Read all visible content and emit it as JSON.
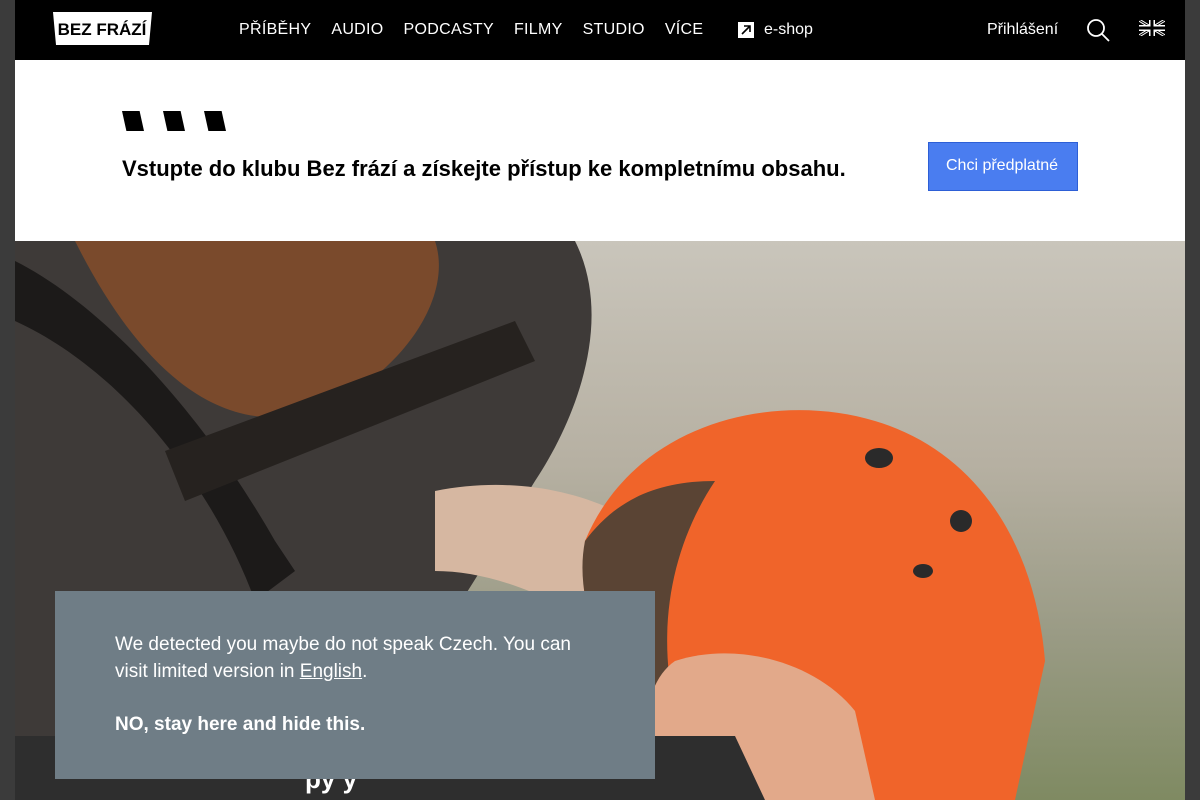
{
  "header": {
    "logo_text": "BEZ FRÁZÍ",
    "nav": [
      "PŘÍBĚHY",
      "AUDIO",
      "PODCASTY",
      "FILMY",
      "STUDIO",
      "VÍCE"
    ],
    "eshop_label": "e-shop",
    "login_label": "Přihlášení",
    "search_icon": "search-icon",
    "language_icon": "uk-flag-icon"
  },
  "promo": {
    "text": "Vstupte do klubu Bez frází a získejte přístup ke kompletnímu obsahu.",
    "button_label": "Chci předplatné",
    "button_color": "#4a7df0"
  },
  "hero": {
    "title_fragment": "py       y",
    "image_alt": "Woman in an orange polo helmet leaning against a horse"
  },
  "language_notice": {
    "message": "We detected you maybe do not speak Czech. You can visit limited version in ",
    "link_label": "English",
    "message_end": ".",
    "dismiss_label": "NO, stay here and hide this.",
    "background_color": "#6f7d86"
  }
}
